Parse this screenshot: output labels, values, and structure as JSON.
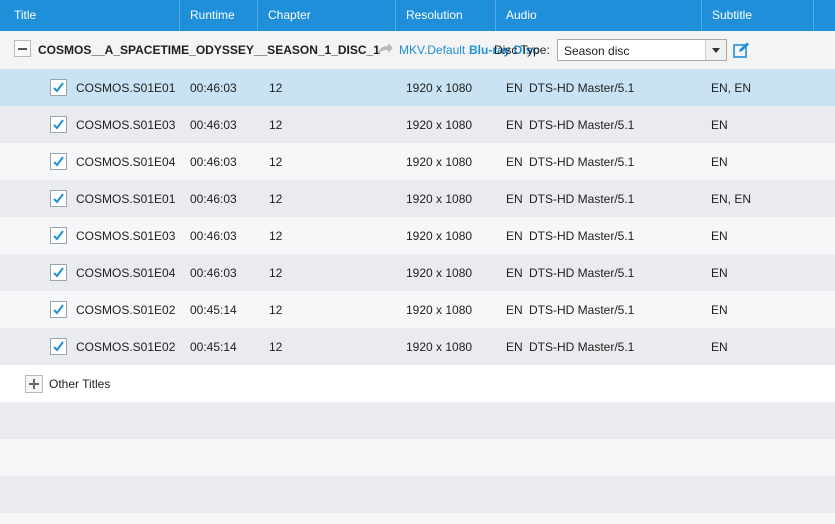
{
  "header": {
    "columns": [
      "Title",
      "Runtime",
      "Chapter",
      "Resolution",
      "Audio",
      "Subtitle"
    ]
  },
  "disc": {
    "title": "COSMOS__A_SPACETIME_ODYSSEY__SEASON_1_DISC_1",
    "profile": "MKV.Default",
    "bluray_label": "Blu-ray Disc",
    "disc_type_label": "Disc Type:",
    "disc_type_value": "Season disc"
  },
  "titles": [
    {
      "name": "COSMOS.S01E01",
      "runtime": "00:46:03",
      "chapters": "12",
      "resolution": "1920 x 1080",
      "audio_lang": "EN",
      "audio_codec": "DTS-HD Master/5.1",
      "subtitle": "EN, EN",
      "checked": true
    },
    {
      "name": "COSMOS.S01E03",
      "runtime": "00:46:03",
      "chapters": "12",
      "resolution": "1920 x 1080",
      "audio_lang": "EN",
      "audio_codec": "DTS-HD Master/5.1",
      "subtitle": "EN",
      "checked": true
    },
    {
      "name": "COSMOS.S01E04",
      "runtime": "00:46:03",
      "chapters": "12",
      "resolution": "1920 x 1080",
      "audio_lang": "EN",
      "audio_codec": "DTS-HD Master/5.1",
      "subtitle": "EN",
      "checked": true
    },
    {
      "name": "COSMOS.S01E01",
      "runtime": "00:46:03",
      "chapters": "12",
      "resolution": "1920 x 1080",
      "audio_lang": "EN",
      "audio_codec": "DTS-HD Master/5.1",
      "subtitle": "EN, EN",
      "checked": true
    },
    {
      "name": "COSMOS.S01E03",
      "runtime": "00:46:03",
      "chapters": "12",
      "resolution": "1920 x 1080",
      "audio_lang": "EN",
      "audio_codec": "DTS-HD Master/5.1",
      "subtitle": "EN",
      "checked": true
    },
    {
      "name": "COSMOS.S01E04",
      "runtime": "00:46:03",
      "chapters": "12",
      "resolution": "1920 x 1080",
      "audio_lang": "EN",
      "audio_codec": "DTS-HD Master/5.1",
      "subtitle": "EN",
      "checked": true
    },
    {
      "name": "COSMOS.S01E02",
      "runtime": "00:45:14",
      "chapters": "12",
      "resolution": "1920 x 1080",
      "audio_lang": "EN",
      "audio_codec": "DTS-HD Master/5.1",
      "subtitle": "EN",
      "checked": true
    },
    {
      "name": "COSMOS.S01E02",
      "runtime": "00:45:14",
      "chapters": "12",
      "resolution": "1920 x 1080",
      "audio_lang": "EN",
      "audio_codec": "DTS-HD Master/5.1",
      "subtitle": "EN",
      "checked": true
    }
  ],
  "other_titles_label": "Other Titles",
  "icons": {
    "collapse": "minus-square-icon",
    "expand": "plus-square-icon",
    "arrow": "share-arrow-icon",
    "edit": "edit-icon",
    "check": "check-icon",
    "dropdown": "chevron-down-icon"
  },
  "colors": {
    "header_bg": "#1e8fd8",
    "accent": "#1e8fd8",
    "selected_row": "#c9e3f4",
    "alt_row": "#e9ebee"
  }
}
